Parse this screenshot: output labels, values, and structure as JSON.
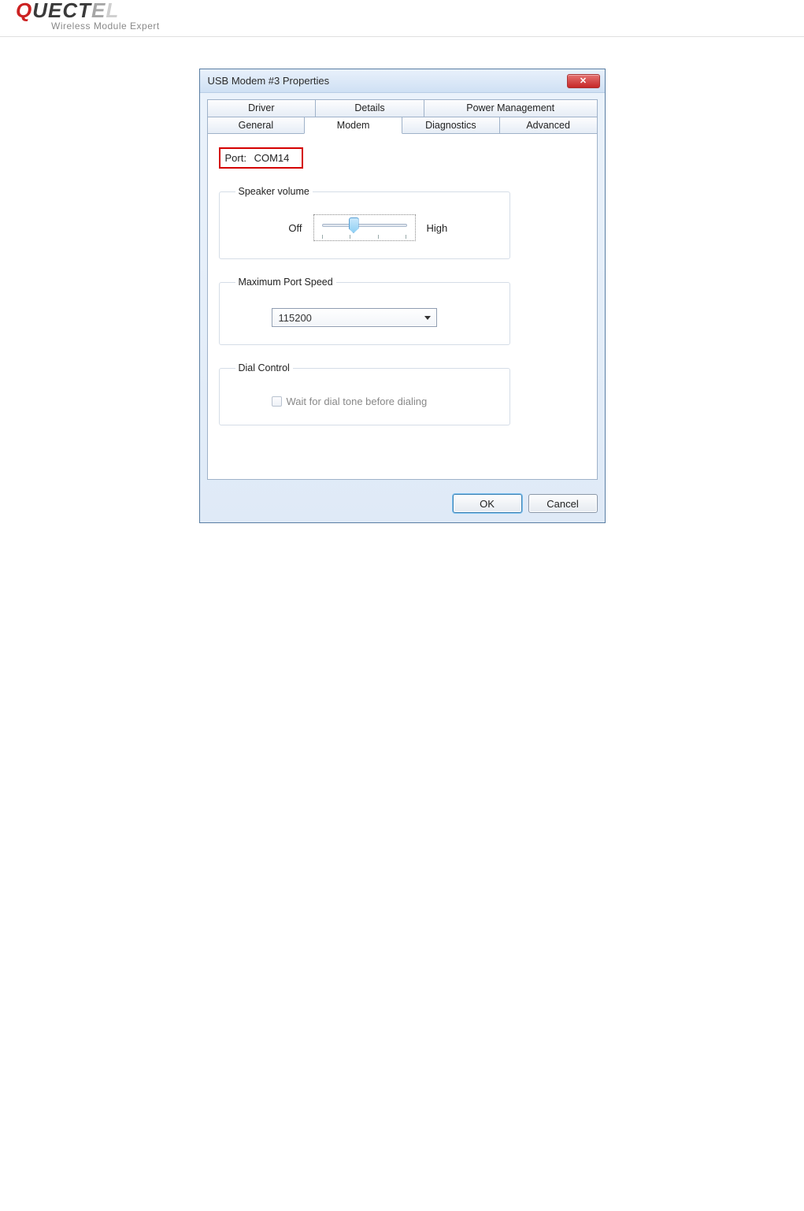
{
  "brand": {
    "name_parts": [
      "Q",
      "U",
      "E",
      "C",
      "T",
      "E",
      "L"
    ],
    "tagline": "Wireless Module Expert"
  },
  "dialog": {
    "title": "USB Modem #3 Properties",
    "tabs_back_row": [
      "Driver",
      "Details",
      "Power Management"
    ],
    "tabs_front_row": [
      "General",
      "Modem",
      "Diagnostics",
      "Advanced"
    ],
    "active_tab": "Modem",
    "port": {
      "label": "Port:",
      "value": "COM14"
    },
    "groups": {
      "speaker": {
        "legend": "Speaker volume",
        "low_label": "Off",
        "high_label": "High"
      },
      "speed": {
        "legend": "Maximum Port Speed",
        "value": "115200"
      },
      "dial": {
        "legend": "Dial Control",
        "checkbox_label": "Wait for dial tone before dialing",
        "checked": false
      }
    },
    "buttons": {
      "ok": "OK",
      "cancel": "Cancel"
    }
  }
}
